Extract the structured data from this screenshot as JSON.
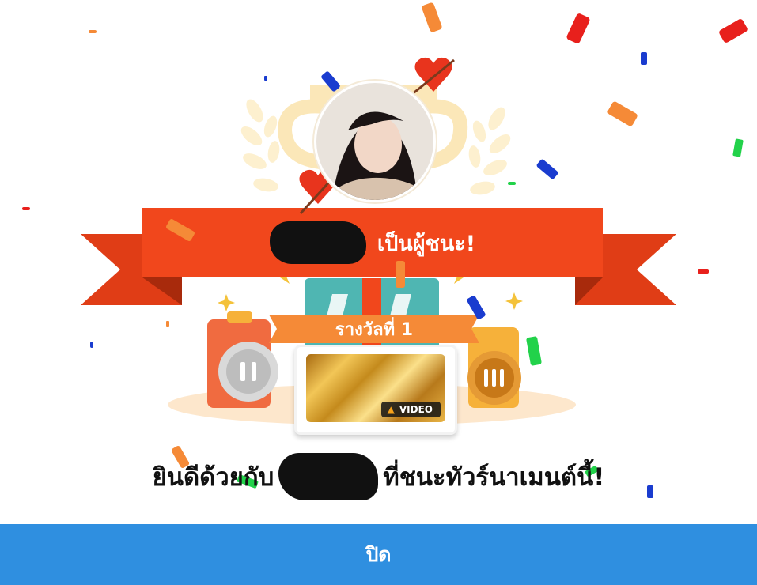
{
  "banner": {
    "winner_suffix": "เป็นผู้ชนะ!"
  },
  "prize": {
    "tag_label": "รางวัลที่ 1",
    "media_badge": "VIDEO",
    "media_badge_icon": "fire-icon"
  },
  "message": {
    "prefix": "ยินดีด้วยกับ",
    "suffix": "ที่ชนะทัวร์นาเมนต์นี้!"
  },
  "close_button": {
    "label": "ปิด"
  },
  "colors": {
    "ribbon": "#f1471c",
    "ribbon_dark": "#c93411",
    "prize_tag": "#f58a37",
    "close_button": "#2f8fe0",
    "trophy_light": "#fbe7b8"
  }
}
